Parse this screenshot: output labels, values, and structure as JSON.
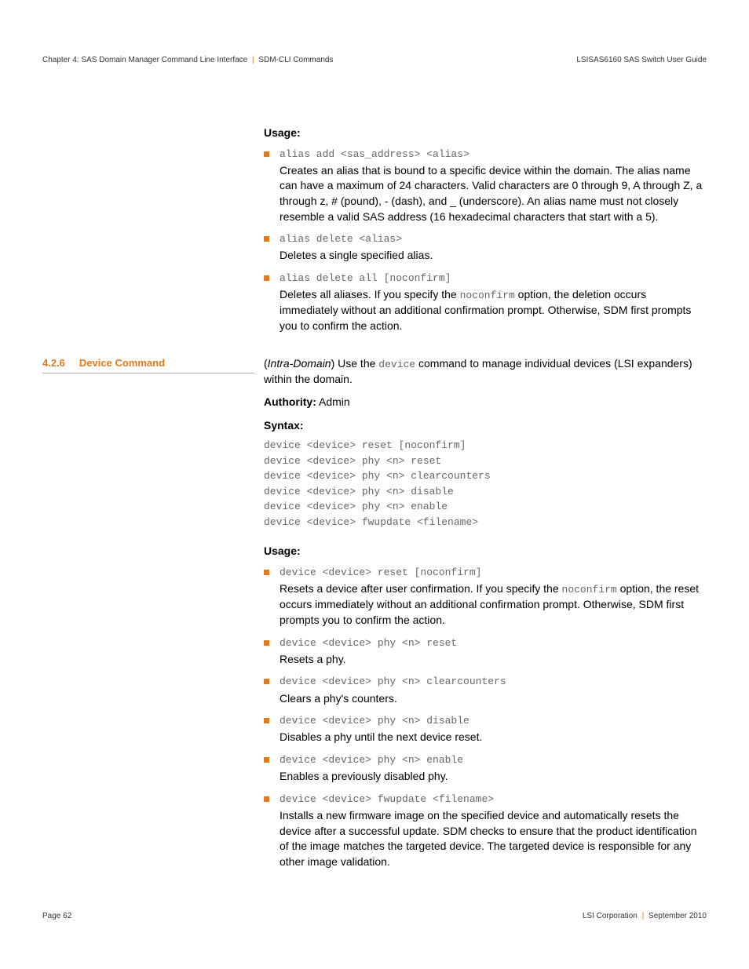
{
  "header": {
    "left_chapter": "Chapter 4: SAS Domain Manager Command Line Interface",
    "left_section": "SDM-CLI Commands",
    "right": "LSISAS6160 SAS Switch User Guide"
  },
  "footer": {
    "left": "Page 62",
    "right_company": "LSI Corporation",
    "right_date": "September 2010"
  },
  "usage1": {
    "title": "Usage:",
    "items": [
      {
        "code": "alias add <sas_address> <alias>",
        "desc": "Creates an alias that is bound to a specific device within the domain. The alias name can have a maximum of 24 characters. Valid characters are 0 through 9, A through Z, a through z, # (pound), - (dash), and _ (underscore). An alias name must not closely resemble a valid SAS address (16 hexadecimal characters that start with a 5)."
      },
      {
        "code": "alias delete <alias>",
        "desc": "Deletes a single specified alias."
      },
      {
        "code": "alias delete all [noconfirm]",
        "desc_pre": "Deletes all aliases. If you specify the ",
        "desc_code": "noconfirm",
        "desc_post": " option, the deletion occurs immediately without an additional confirmation prompt. Otherwise, SDM first prompts you to confirm the action."
      }
    ]
  },
  "section": {
    "number": "4.2.6",
    "title": "Device Command",
    "intro_pre": "(",
    "intro_italic": "Intra-Domain",
    "intro_mid": ") Use the ",
    "intro_code": "device",
    "intro_post": " command to manage individual devices (LSI expanders) within the domain.",
    "authority_label": "Authority:",
    "authority_val": " Admin",
    "syntax_label": "Syntax:",
    "syntax_block": "device <device> reset [noconfirm]\ndevice <device> phy <n> reset\ndevice <device> phy <n> clearcounters\ndevice <device> phy <n> disable\ndevice <device> phy <n> enable\ndevice <device> fwupdate <filename>"
  },
  "usage2": {
    "title": "Usage:",
    "items": [
      {
        "code": "device <device> reset [noconfirm]",
        "desc_pre": "Resets a device after user confirmation. If you specify the ",
        "desc_code": "noconfirm",
        "desc_post": " option, the reset occurs immediately without an additional confirmation prompt. Otherwise, SDM first prompts you to confirm the action."
      },
      {
        "code": "device <device> phy <n> reset",
        "desc": "Resets a phy."
      },
      {
        "code": "device <device> phy <n> clearcounters",
        "desc": "Clears a phy's counters."
      },
      {
        "code": "device <device> phy <n> disable",
        "desc": "Disables a phy until the next device reset."
      },
      {
        "code": "device <device> phy <n> enable",
        "desc": "Enables a previously disabled phy."
      },
      {
        "code": "device <device> fwupdate <filename>",
        "desc": "Installs a new firmware image on the specified device and automatically resets the device after a successful update. SDM checks to ensure that the product identification of the image matches the targeted device. The targeted device is responsible for any other image validation."
      }
    ]
  }
}
